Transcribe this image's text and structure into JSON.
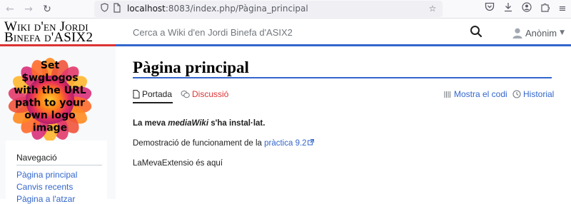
{
  "browser": {
    "url_host": "localhost",
    "url_rest": ":8083/index.php/Pàgina_principal"
  },
  "header": {
    "wordmark_line1": "Wiki d'en Jordi",
    "wordmark_line2": "Binefa d'ASIX2",
    "search_placeholder": "Cerca a Wiki d'en Jordi Binefa d'ASIX2",
    "user_label": "Anònim"
  },
  "sidebar": {
    "logo_text": [
      "Set",
      "$wgLogos",
      "with the URL",
      "path to your",
      "own logo",
      "image"
    ],
    "nav_heading": "Navegació",
    "nav_items": [
      "Pàgina principal",
      "Canvis recents",
      "Pàgina a l'atzar"
    ]
  },
  "content": {
    "title": "Pàgina principal",
    "tabs": {
      "page": "Portada",
      "discussion": "Discussió",
      "view_source": "Mostra el codi",
      "history": "Historial"
    },
    "para1_prefix": "La meva ",
    "para1_em": "mediaWiki",
    "para1_suffix": " s'ha instal·lat.",
    "para2_prefix": "Demostració de funcionament de la ",
    "para2_link": "pràctica 9.2",
    "para3": "LaMevaExtensio és aquí"
  },
  "colors": {
    "link": "#3366cc",
    "red_link": "#d33",
    "accent_blue": "#3366cc",
    "accent_red": "#dd3333"
  }
}
